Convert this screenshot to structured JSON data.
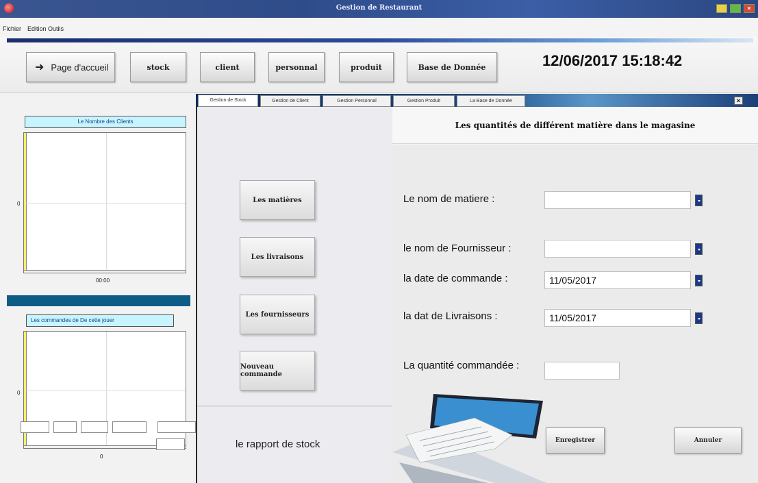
{
  "window": {
    "title": "Gestion de Restaurant"
  },
  "menu": [
    "Fichier",
    "Edition",
    "Outils"
  ],
  "nav": {
    "home": "Page d'accueil",
    "stock": "stock",
    "client": "client",
    "personnal": "personnal",
    "produit": "produit",
    "db": "Base de Donnée"
  },
  "datetime": "12/06/2017 15:18:42",
  "left": {
    "chart1_title": "Le Nombre des Clients",
    "chart1_y": "0",
    "chart1_x": "00:00",
    "chart2_title": "Les commandes de De cette jouer",
    "chart2_y": "0",
    "chart2_x": "0"
  },
  "tabs": [
    "Gestion de Stock",
    "Gestion de Client",
    "Gestion Personnal",
    "Gestion Produit",
    "La Base de Donnée"
  ],
  "side_buttons": [
    "Les matières",
    "Les livraisons",
    "Les fournisseurs",
    "Nouveau commande"
  ],
  "rapport": "le rapport de stock",
  "form": {
    "header": "Les quantités de différent matière dans le magasine",
    "matiere_label": "Le nom de matiere :",
    "matiere_value": "",
    "fournisseur_label": "le nom de Fournisseur  :",
    "fournisseur_value": "",
    "date_cmd_label": "la date de commande  :",
    "date_cmd_value": "11/05/2017",
    "date_liv_label": "la dat de Livraisons  :",
    "date_liv_value": "11/05/2017",
    "quantite_label": "La quantité commandée  :",
    "quantite_value": "",
    "save": "Enregistrer",
    "cancel": "Annuler"
  }
}
